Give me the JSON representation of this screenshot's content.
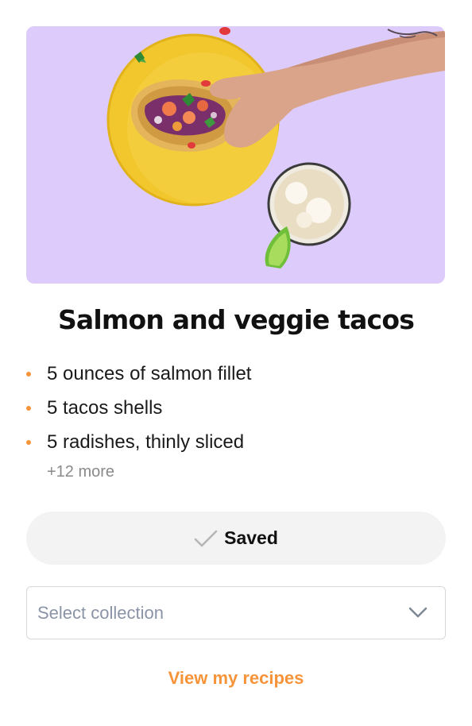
{
  "recipe": {
    "image_alt": "Hand holding a salmon taco over a yellow plate with a drink and lime",
    "title": "Salmon and veggie tacos",
    "ingredients": [
      "5 ounces of salmon fillet",
      "5 tacos shells",
      "5 radishes, thinly sliced"
    ],
    "more_label": "+12 more"
  },
  "actions": {
    "saved_label": "Saved",
    "saved_icon": "check-icon",
    "collection_placeholder": "Select collection",
    "collection_icon": "chevron-down-icon",
    "view_recipes_label": "View my recipes"
  },
  "colors": {
    "hero_background": "#ddccfb",
    "accent": "#f7943a",
    "button_background": "#f3f3f3",
    "placeholder_text": "#8a94a6"
  }
}
